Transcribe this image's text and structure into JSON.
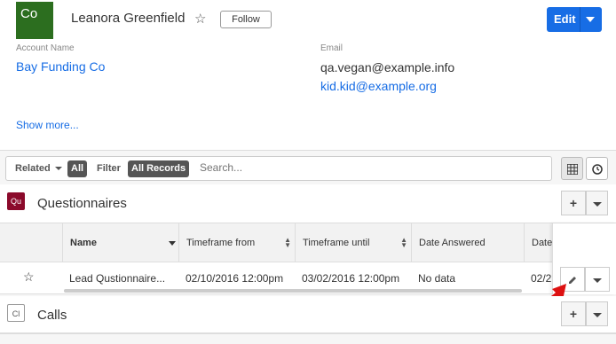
{
  "record": {
    "avatar_text": "Co",
    "name": "Leanora Greenfield",
    "follow_label": "Follow",
    "edit_label": "Edit"
  },
  "details": {
    "account_name_label": "Account Name",
    "account_name_value": "Bay Funding Co",
    "email_label": "Email",
    "emails": [
      "qa.vegan@example.info",
      "kid.kid@example.org"
    ],
    "show_more": "Show more..."
  },
  "filter": {
    "related_label": "Related",
    "related_value": "All",
    "filter_label": "Filter",
    "filter_value": "All Records",
    "search_placeholder": "Search..."
  },
  "subpanels": [
    {
      "icon_text": "Qu",
      "title": "Questionnaires"
    },
    {
      "icon_text": "Cl",
      "title": "Calls"
    }
  ],
  "table": {
    "columns": [
      "Name",
      "Timeframe from",
      "Timeframe until",
      "Date Answered",
      "Date"
    ],
    "rows": [
      {
        "name": "Lead Qustionnaire...",
        "from": "02/10/2016 12:00pm",
        "until": "03/02/2016 12:00pm",
        "answered": "No data",
        "date": "02/2"
      }
    ]
  },
  "colors": {
    "accent": "#176de5",
    "avatar_bg": "#2c6e1f",
    "questionnaire_icon": "#8b0a2b",
    "arrow": "#dd1111"
  }
}
